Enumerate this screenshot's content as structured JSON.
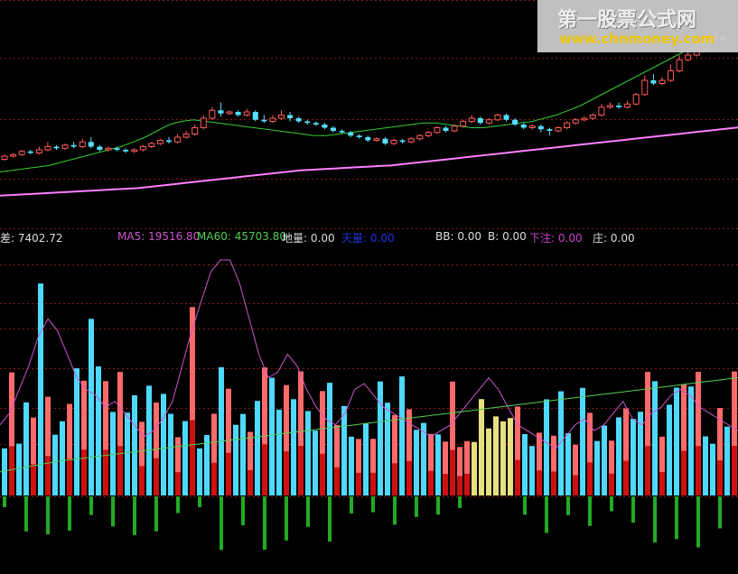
{
  "watermark": {
    "title": "第一股票公式网",
    "url": "www.chnmoney.com"
  },
  "legend": {
    "diff": {
      "label": "差",
      "value": "7402.72"
    },
    "ma5": {
      "label": "MA5",
      "value": "19516.80"
    },
    "ma60": {
      "label": "MA60",
      "value": "45703.80"
    },
    "diliang": {
      "label": "地量",
      "value": "0.00"
    },
    "tianliang": {
      "label": "天量",
      "value": "0.00"
    },
    "bb": {
      "label": "BB",
      "value": "0.00"
    },
    "b": {
      "label": "B",
      "value": "0.00"
    },
    "xiazhu": {
      "label": "下注",
      "value": "0.00"
    },
    "zhuang": {
      "label": "庄",
      "value": "0.00"
    }
  },
  "colors": {
    "background": "#000000",
    "grid": "#8b1a1a",
    "up_candle": "#ff5a5a",
    "down_candle": "#54e0ff",
    "pink_line": "#ff7fff",
    "green_line": "#33cc33",
    "up_bar": "#ff6a6a",
    "down_bar": "#4fd9ff",
    "red_base": "#cc1111",
    "green_bar": "#22aa22",
    "yellow_bar": "#e8e080",
    "ma5_color": "#cc55cc",
    "ma60_color": "#55cc55",
    "tianliang_color": "#2233dd",
    "xiazhu_color": "#cc44cc",
    "text_color": "#dddddd"
  },
  "chart_data": [
    {
      "type": "candlestick",
      "price_range": [
        0,
        100
      ],
      "candles": [
        [
          22,
          24,
          21,
          25,
          "u"
        ],
        [
          24,
          25,
          23,
          26,
          "u"
        ],
        [
          25,
          27,
          24,
          28,
          "u"
        ],
        [
          27,
          26,
          25,
          28,
          "d"
        ],
        [
          26,
          28,
          25,
          30,
          "u"
        ],
        [
          28,
          30,
          27,
          33,
          "u"
        ],
        [
          30,
          29,
          28,
          31,
          "d"
        ],
        [
          29,
          31,
          28,
          32,
          "u"
        ],
        [
          31,
          30,
          29,
          33,
          "d"
        ],
        [
          30,
          33,
          29,
          35,
          "u"
        ],
        [
          33,
          30,
          29,
          36,
          "d"
        ],
        [
          30,
          28,
          27,
          31,
          "d"
        ],
        [
          28,
          29,
          27,
          30,
          "u"
        ],
        [
          29,
          28,
          27,
          30,
          "d"
        ],
        [
          28,
          27,
          26,
          29,
          "d"
        ],
        [
          27,
          28,
          26,
          29,
          "u"
        ],
        [
          28,
          30,
          27,
          31,
          "u"
        ],
        [
          30,
          32,
          29,
          33,
          "u"
        ],
        [
          32,
          34,
          31,
          35,
          "u"
        ],
        [
          34,
          33,
          32,
          36,
          "d"
        ],
        [
          33,
          36,
          32,
          38,
          "u"
        ],
        [
          36,
          38,
          35,
          40,
          "u"
        ],
        [
          38,
          42,
          37,
          44,
          "u"
        ],
        [
          42,
          48,
          41,
          50,
          "u"
        ],
        [
          48,
          53,
          47,
          55,
          "u"
        ],
        [
          53,
          51,
          49,
          58,
          "d"
        ],
        [
          51,
          52,
          50,
          53,
          "u"
        ],
        [
          52,
          50,
          49,
          53,
          "d"
        ],
        [
          50,
          52,
          49,
          54,
          "u"
        ],
        [
          52,
          47,
          46,
          53,
          "d"
        ],
        [
          47,
          46,
          45,
          50,
          "d"
        ],
        [
          46,
          48,
          45,
          50,
          "u"
        ],
        [
          48,
          50,
          47,
          53,
          "u"
        ],
        [
          50,
          48,
          46,
          52,
          "d"
        ],
        [
          48,
          46,
          45,
          49,
          "d"
        ],
        [
          46,
          45,
          44,
          47,
          "d"
        ],
        [
          45,
          44,
          43,
          46,
          "d"
        ],
        [
          44,
          42,
          41,
          45,
          "d"
        ],
        [
          42,
          40,
          39,
          43,
          "d"
        ],
        [
          40,
          39,
          38,
          41,
          "d"
        ],
        [
          39,
          37,
          36,
          40,
          "d"
        ],
        [
          37,
          36,
          35,
          38,
          "d"
        ],
        [
          36,
          34,
          33,
          37,
          "d"
        ],
        [
          34,
          35,
          33,
          36,
          "u"
        ],
        [
          35,
          32,
          31,
          36,
          "d"
        ],
        [
          32,
          34,
          31,
          35,
          "u"
        ],
        [
          34,
          33,
          32,
          35,
          "d"
        ],
        [
          33,
          35,
          32,
          36,
          "u"
        ],
        [
          35,
          37,
          34,
          38,
          "u"
        ],
        [
          37,
          39,
          36,
          40,
          "u"
        ],
        [
          39,
          42,
          38,
          43,
          "u"
        ],
        [
          42,
          40,
          39,
          43,
          "d"
        ],
        [
          40,
          43,
          39,
          44,
          "u"
        ],
        [
          43,
          46,
          42,
          47,
          "u"
        ],
        [
          46,
          48,
          45,
          50,
          "u"
        ],
        [
          48,
          45,
          44,
          49,
          "d"
        ],
        [
          45,
          47,
          44,
          48,
          "u"
        ],
        [
          47,
          50,
          46,
          51,
          "u"
        ],
        [
          50,
          47,
          46,
          51,
          "d"
        ],
        [
          47,
          44,
          43,
          48,
          "d"
        ],
        [
          44,
          42,
          41,
          45,
          "d"
        ],
        [
          42,
          43,
          41,
          44,
          "u"
        ],
        [
          43,
          41,
          39,
          44,
          "d"
        ],
        [
          41,
          40,
          37,
          42,
          "d"
        ],
        [
          40,
          42,
          39,
          43,
          "u"
        ],
        [
          42,
          45,
          41,
          46,
          "u"
        ],
        [
          45,
          47,
          44,
          48,
          "u"
        ],
        [
          47,
          48,
          46,
          49,
          "u"
        ],
        [
          48,
          50,
          47,
          51,
          "u"
        ],
        [
          50,
          55,
          49,
          57,
          "u"
        ],
        [
          55,
          56,
          54,
          58,
          "u"
        ],
        [
          56,
          55,
          54,
          58,
          "d"
        ],
        [
          55,
          57,
          54,
          59,
          "u"
        ],
        [
          57,
          63,
          56,
          64,
          "u"
        ],
        [
          63,
          72,
          62,
          75,
          "u"
        ],
        [
          72,
          70,
          69,
          76,
          "d"
        ],
        [
          70,
          72,
          69,
          74,
          "u"
        ],
        [
          72,
          78,
          71,
          82,
          "u"
        ],
        [
          78,
          85,
          77,
          88,
          "u"
        ],
        [
          85,
          88,
          84,
          92,
          "u"
        ],
        [
          88,
          92,
          87,
          96,
          "u"
        ],
        [
          92,
          96,
          91,
          98,
          "u"
        ],
        [
          96,
          99,
          95,
          100,
          "u"
        ],
        [
          99,
          98,
          96,
          100,
          "d"
        ]
      ],
      "pink_ma": [
        8,
        8.5,
        9,
        9.5,
        10,
        10.5,
        11,
        11.5,
        12,
        12.5,
        13,
        13.5,
        14,
        15,
        16,
        17,
        18,
        19,
        20,
        21,
        22,
        23,
        24,
        25,
        26,
        27,
        28,
        28.5,
        29,
        29.5,
        30,
        30.5,
        31,
        31.5,
        32,
        33,
        34,
        35,
        36,
        37,
        38,
        39,
        40,
        41,
        42,
        43,
        44,
        45,
        46,
        47,
        48,
        49,
        50,
        51,
        52,
        53,
        54,
        55,
        56,
        57,
        58,
        59,
        60,
        61,
        62
      ],
      "green_ma": [
        14,
        15,
        16,
        17,
        18,
        20,
        22,
        24,
        26,
        28,
        30,
        33,
        36,
        40,
        44,
        46,
        47,
        46,
        45,
        44,
        43,
        42,
        41,
        40,
        39,
        38,
        37,
        37,
        38,
        39,
        40,
        41,
        42,
        43,
        44,
        45,
        45,
        44,
        43,
        42,
        42,
        43,
        44,
        45,
        46,
        48,
        50,
        53,
        56,
        60,
        64,
        68,
        72,
        76,
        80,
        84,
        88,
        92,
        95,
        98
      ]
    },
    {
      "type": "bar",
      "axis_range": [
        -12,
        42
      ],
      "ma_line_5": [
        12,
        14,
        18,
        22,
        27,
        30,
        28,
        24,
        20,
        18,
        17,
        15,
        16,
        14,
        12,
        10,
        11,
        13,
        16,
        22,
        28,
        33,
        38,
        40,
        40,
        36,
        30,
        24,
        20,
        21,
        24,
        22,
        18,
        15,
        13,
        12,
        14,
        18,
        19,
        17,
        15,
        14,
        13,
        12,
        11,
        10,
        11,
        12,
        14,
        16,
        18,
        20,
        18,
        15,
        12,
        11,
        10,
        9,
        8,
        10,
        12,
        13,
        11,
        12,
        14,
        16,
        13,
        12,
        14,
        15,
        17,
        18,
        17,
        15,
        14,
        13,
        12,
        11
      ],
      "ma_line_60": [
        10,
        10.3,
        10.6,
        10.9,
        11.2,
        11.5,
        11.8,
        12,
        12.2,
        12.4,
        12.6,
        12.8,
        13,
        13.2,
        13.4,
        13.6,
        13.8,
        14,
        14.2,
        14.4,
        14.6,
        14.8,
        15,
        15.2,
        15.4,
        15.6,
        15.8,
        16,
        16.2,
        16.4,
        16.6,
        16.8,
        17,
        17.2,
        17.4,
        17.6,
        17.8,
        18,
        18.2,
        18.4,
        18.6,
        18.8,
        19,
        19.2,
        19.4,
        19.6,
        19.8,
        20,
        20.2,
        20.4,
        20.6,
        20.8,
        21,
        21.2,
        21.4,
        21.6,
        21.8,
        22,
        22.2,
        22.4,
        22.6,
        22.8,
        23,
        23.2,
        23.4,
        23.6,
        23.8,
        24,
        24.2,
        24.4,
        24.6,
        24.8,
        25,
        25.2,
        25.4,
        25.6,
        25.8,
        26
      ]
    }
  ]
}
